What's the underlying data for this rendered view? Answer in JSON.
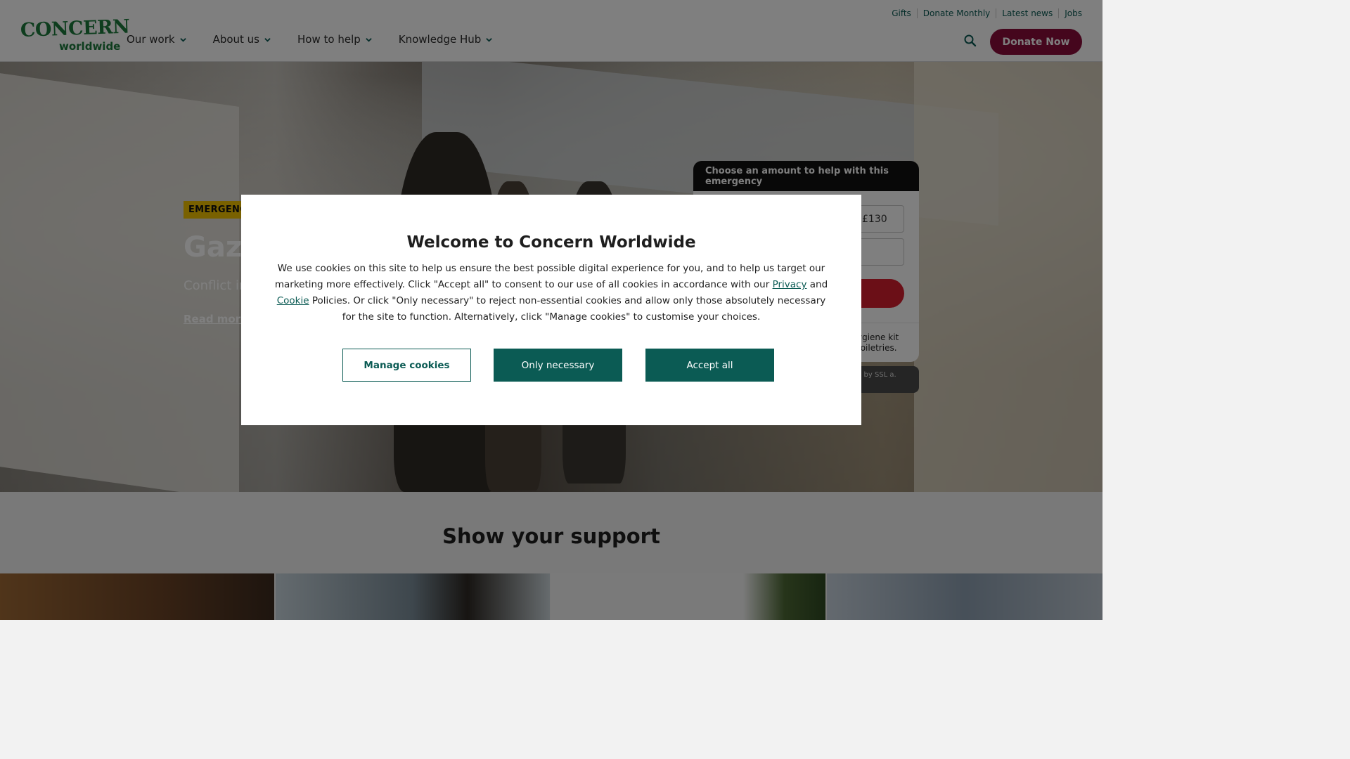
{
  "header": {
    "logo_top": "CONCERN",
    "logo_bottom": "worldwide",
    "utility_links": [
      "Gifts",
      "Donate Monthly",
      "Latest news",
      "Jobs"
    ],
    "nav": [
      "Our work",
      "About us",
      "How to help",
      "Knowledge Hub"
    ],
    "donate_label": "Donate Now"
  },
  "hero": {
    "badge": "EMERGENCY",
    "title": "Gaza",
    "description": "Conflict in our emerg",
    "read_more": "Read more"
  },
  "widget": {
    "heading": "Choose an amount to help with this emergency",
    "amount_visible": "£130",
    "note": "ygiene kit toiletries.",
    "ssl": "d by SSL a."
  },
  "support": {
    "title": "Show your support"
  },
  "cookie_modal": {
    "title": "Welcome to Concern Worldwide",
    "body_before_privacy": "We use cookies on this site to help us ensure the best possible digital experience for you, and to help us target our marketing more effectively. Click \"Accept all\" to consent to our use of all cookies in accordance with our ",
    "privacy_link": "Privacy",
    "and_text": " and ",
    "cookie_link": "Cookie",
    "body_after": " Policies. Or click \"Only necessary\" to reject non-essential cookies and allow only those absolutely necessary for the site to function. Alternatively, click \"Manage cookies\" to customise your choices.",
    "manage_label": "Manage cookies",
    "necessary_label": "Only necessary",
    "accept_label": "Accept all"
  },
  "colors": {
    "brand_green": "#0b5b54",
    "logo_green": "#1d7a3c",
    "donate_maroon": "#8a0d3a",
    "badge_yellow": "#f2c300",
    "widget_red": "#d71f2f"
  },
  "icons": {
    "search": "search-icon",
    "chevron": "chevron-down-icon"
  }
}
